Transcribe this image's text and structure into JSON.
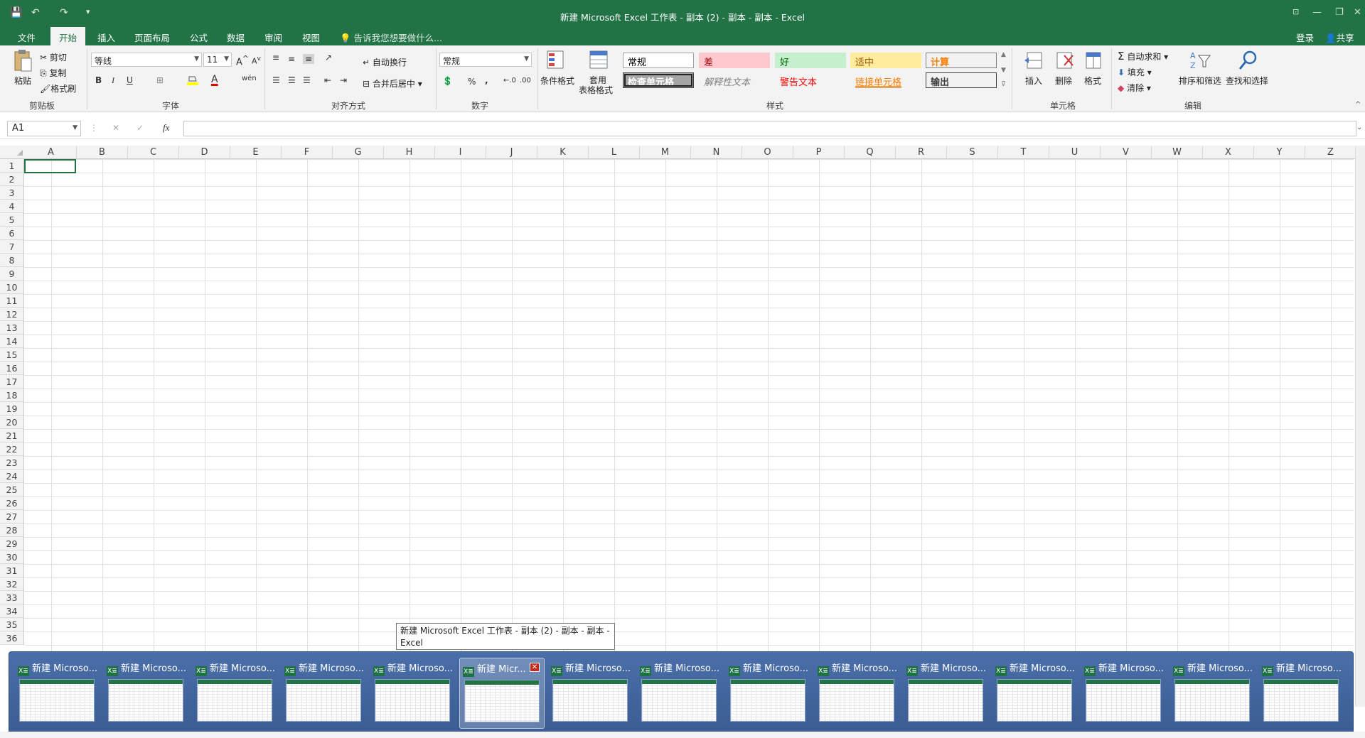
{
  "window": {
    "title": "新建 Microsoft Excel 工作表 - 副本 (2) - 副本 - 副本 - Excel",
    "qat_save": "💾",
    "qat_undo": "↶",
    "qat_redo": "↷",
    "qat_more": "▾",
    "btn_restore_ribbon": "⊡",
    "btn_min": "—",
    "btn_max": "❐",
    "btn_close": "✕"
  },
  "tabs": [
    "文件",
    "开始",
    "插入",
    "页面布局",
    "公式",
    "数据",
    "审阅",
    "视图"
  ],
  "active_tab": "开始",
  "tell_me": "告诉我您想要做什么...",
  "account": {
    "login": "登录",
    "share": "共享"
  },
  "ribbon": {
    "clipboard": {
      "label": "剪贴板",
      "paste": "粘贴",
      "cut": "剪切",
      "copy": "复制",
      "format_painter": "格式刷"
    },
    "font": {
      "label": "字体",
      "font_name": "等线",
      "font_size": "11",
      "bold": "B",
      "italic": "I",
      "underline": "U"
    },
    "alignment": {
      "label": "对齐方式",
      "wrap": "自动换行",
      "merge": "合并后居中"
    },
    "number": {
      "label": "数字",
      "format": "常规",
      "percent": "%",
      "comma": ","
    },
    "styles": {
      "label": "样式",
      "conditional": "条件格式",
      "table_format_line1": "套用",
      "table_format_line2": "表格格式",
      "cells": [
        {
          "text": "常规",
          "fg": "#000000",
          "bg": "#ffffff",
          "border": "#a0a0a0"
        },
        {
          "text": "差",
          "fg": "#9c0006",
          "bg": "#ffc7ce",
          "border": "#ffc7ce"
        },
        {
          "text": "好",
          "fg": "#006100",
          "bg": "#c6efce",
          "border": "#c6efce"
        },
        {
          "text": "适中",
          "fg": "#9c5700",
          "bg": "#ffeb9c",
          "border": "#ffeb9c"
        },
        {
          "text": "计算",
          "fg": "#fa7d00",
          "bg": "#f2f2f2",
          "border": "#7f7f7f"
        },
        {
          "text": "检查单元格",
          "fg": "#ffffff",
          "bg": "#a5a5a5",
          "border": "#3f3f3f"
        },
        {
          "text": "解释性文本",
          "fg": "#7f7f7f",
          "bg": "transparent",
          "border": "transparent"
        },
        {
          "text": "警告文本",
          "fg": "#ff0000",
          "bg": "transparent",
          "border": "transparent"
        },
        {
          "text": "链接单元格",
          "fg": "#fa7d00",
          "bg": "transparent",
          "border": "transparent"
        },
        {
          "text": "输出",
          "fg": "#3f3f3f",
          "bg": "#f2f2f2",
          "border": "#3f3f3f"
        }
      ]
    },
    "cells_group": {
      "label": "单元格",
      "insert": "插入",
      "delete": "删除",
      "format": "格式"
    },
    "editing": {
      "label": "编辑",
      "autosum": "自动求和",
      "fill": "填充",
      "clear": "清除",
      "sort": "排序和筛选",
      "find": "查找和选择"
    }
  },
  "formula_bar": {
    "name_box": "A1",
    "cancel": "✕",
    "enter": "✓",
    "fx": "fx",
    "value": ""
  },
  "columns": [
    "A",
    "B",
    "C",
    "D",
    "E",
    "F",
    "G",
    "H",
    "I",
    "J",
    "K",
    "L",
    "M",
    "N",
    "O",
    "P",
    "Q",
    "R",
    "S",
    "T",
    "U",
    "V",
    "W",
    "X",
    "Y",
    "Z"
  ],
  "rows": [
    "1",
    "2",
    "3",
    "4",
    "5",
    "6",
    "7",
    "8",
    "9",
    "10",
    "11",
    "12",
    "13",
    "14",
    "15",
    "16",
    "17",
    "18",
    "19",
    "20",
    "21",
    "22",
    "23",
    "24",
    "25",
    "26",
    "27",
    "28",
    "29",
    "30",
    "31",
    "32",
    "33",
    "34",
    "35",
    "36"
  ],
  "taskbar_preview": {
    "tooltip_line1": "新建 Microsoft Excel 工作表 - 副本 (2) - 副本 - 副本 -",
    "tooltip_line2": "Excel",
    "app_icon": "X≣",
    "close_glyph": "✕",
    "active_index": 5,
    "windows": [
      "新建 Microso...",
      "新建 Microso...",
      "新建 Microso...",
      "新建 Microso...",
      "新建 Microso...",
      "新建 Micr...",
      "新建 Microso...",
      "新建 Microso...",
      "新建 Microso...",
      "新建 Microso...",
      "新建 Microso...",
      "新建 Microso...",
      "新建 Microso...",
      "新建 Microso...",
      "新建 Microso..."
    ]
  }
}
